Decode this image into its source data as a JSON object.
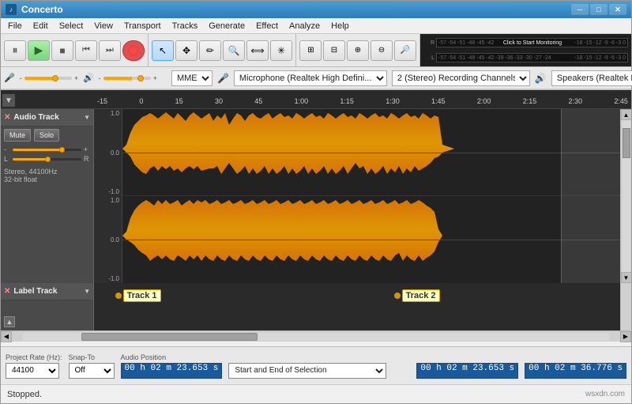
{
  "window": {
    "title": "Concerto",
    "icon": "♪"
  },
  "winControls": {
    "minimize": "─",
    "maximize": "□",
    "close": "✕"
  },
  "menu": {
    "items": [
      "File",
      "Edit",
      "Select",
      "View",
      "Transport",
      "Tracks",
      "Generate",
      "Effect",
      "Analyze",
      "Help"
    ]
  },
  "toolbar": {
    "row1": {
      "pause": "⏸",
      "play": "▶",
      "stop": "■",
      "skipBack": "⏮",
      "skipFwd": "⏭",
      "record": "●"
    },
    "tools": [
      "↖",
      "✥",
      "✂",
      "🔍",
      "✏",
      "☁"
    ],
    "meter": {
      "labels": [
        "-57",
        "-54",
        "-51",
        "-48",
        "-45",
        "-42"
      ],
      "labels2": [
        "-18",
        "-15",
        "-12",
        "-9",
        "-6",
        "-3",
        "0"
      ],
      "monitorBtn": "Click to Start Monitoring",
      "labels3": [
        "-57",
        "-54",
        "-51",
        "-48",
        "-45",
        "-42",
        "-39",
        "-36",
        "-33",
        "-30",
        "-27",
        "-24"
      ],
      "labels4": [
        "-18",
        "-15",
        "-12",
        "-9",
        "-6",
        "-3",
        "0"
      ]
    }
  },
  "mixer": {
    "inputVol": 60,
    "outputVol": 75,
    "micLabel": "🎤",
    "speakerLabel": "🔊",
    "devices": {
      "api": "MME",
      "input": "Microphone (Realtek High Defini...",
      "channels": "2 (Stereo) Recording Channels",
      "output": "Speakers (Realtek High Definiti..."
    }
  },
  "timeline": {
    "marks": [
      "-15",
      "0",
      "15",
      "30",
      "45",
      "1:00",
      "1:15",
      "1:30",
      "1:45",
      "2:00",
      "2:15",
      "2:30",
      "2:45"
    ]
  },
  "audioTrack": {
    "name": "Audio Track",
    "closeBtn": "✕",
    "muteLabel": "Mute",
    "soloLabel": "Solo",
    "volLabel": "-",
    "volPlus": "+",
    "volPercent": 70,
    "panLeft": "L",
    "panRight": "R",
    "panPercent": 50,
    "info": "Stereo, 44100Hz\n32-bit float"
  },
  "labelTrack": {
    "name": "Label Track",
    "closeBtn": "✕",
    "labels": [
      {
        "id": "track1",
        "text": "Track 1",
        "leftPercent": 5
      },
      {
        "id": "track2",
        "text": "Track 2",
        "leftPercent": 58
      }
    ]
  },
  "bottomControls": {
    "projectRateLabel": "Project Rate (Hz):",
    "projectRate": "44100",
    "snapToLabel": "Snap-To",
    "snapToValue": "Off",
    "audioPosLabel": "Audio Position",
    "audioPos": "00 h 02 m 23.653 s",
    "selectionModeLabel": "Start and End of Selection",
    "selStart": "00 h 02 m 23.653 s",
    "selEnd": "00 h 02 m 36.776 s"
  },
  "statusBar": {
    "text": "Stopped.",
    "watermark": "wsxdn.com"
  }
}
